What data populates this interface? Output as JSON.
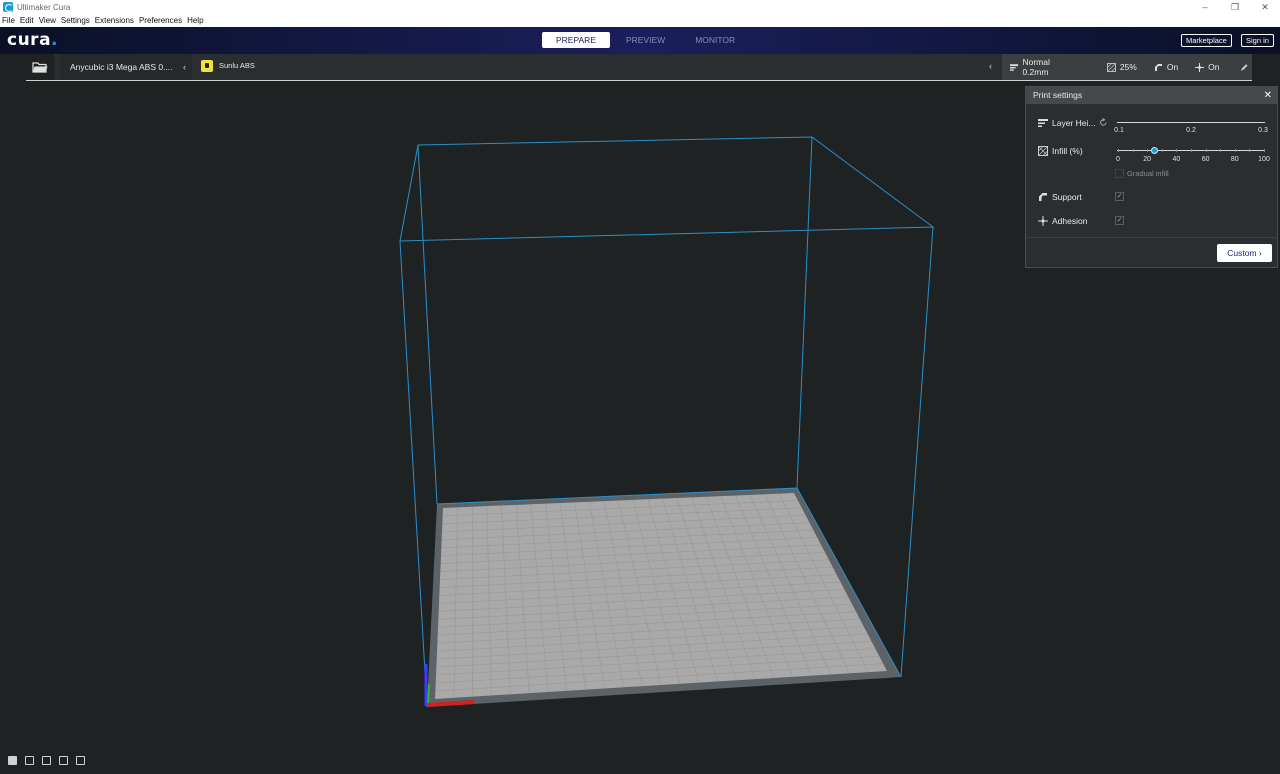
{
  "window": {
    "title": "Ultimaker Cura",
    "controls": [
      "–",
      "❐",
      "✕"
    ]
  },
  "menu": [
    "File",
    "Edit",
    "View",
    "Settings",
    "Extensions",
    "Preferences",
    "Help"
  ],
  "header": {
    "logo": "cura",
    "stages": [
      {
        "label": "PREPARE",
        "active": true
      },
      {
        "label": "PREVIEW",
        "active": false
      },
      {
        "label": "MONITOR",
        "active": false
      }
    ],
    "marketplace": "Marketplace",
    "sign_in": "Sign in"
  },
  "toolbar": {
    "printer": "Anycubic i3 Mega ABS 0....",
    "material": "Sunlu ABS",
    "profile": "Normal 0.2mm",
    "infill": "25%",
    "support": "On",
    "adhesion": "On"
  },
  "print_settings": {
    "title": "Print settings",
    "layer_height": {
      "label": "Layer Hei...",
      "ticks": [
        "0.1",
        "0.2",
        "0.3"
      ]
    },
    "infill": {
      "label": "Infill (%)",
      "ticks": [
        "0",
        "20",
        "40",
        "60",
        "80",
        "100"
      ],
      "value_percent": 25,
      "gradual_label": "Gradual infill",
      "gradual_checked": false
    },
    "support": {
      "label": "Support",
      "checked": true
    },
    "adhesion": {
      "label": "Adhesion",
      "checked": true
    },
    "custom_button": "Custom"
  },
  "colors": {
    "accent": "#1a9bd7",
    "background": "#1f2223",
    "build_volume_line": "#2b8fc6",
    "build_plate": "#a9a9a9",
    "build_plate_border": "#5c6266"
  },
  "camera_buttons": [
    "3d-view-icon",
    "front-view-icon",
    "top-view-icon",
    "left-view-icon",
    "right-view-icon"
  ]
}
